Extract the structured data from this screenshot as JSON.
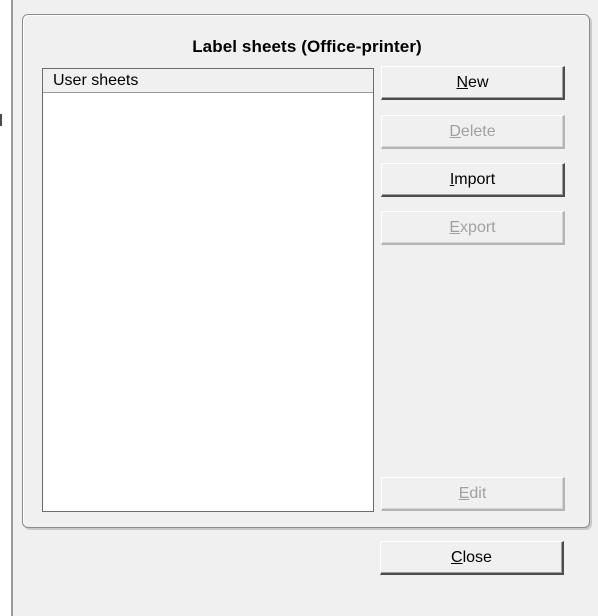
{
  "dialog": {
    "group_title": "Label sheets (Office-printer)",
    "list": {
      "header": "User sheets",
      "items": []
    },
    "buttons": {
      "new": {
        "accel": "N",
        "rest": "ew",
        "enabled": true
      },
      "delete": {
        "accel": "D",
        "rest": "elete",
        "enabled": false
      },
      "import": {
        "accel": "I",
        "rest": "mport",
        "enabled": true
      },
      "export": {
        "accel": "E",
        "rest": "xport",
        "enabled": false
      },
      "edit": {
        "accel": "E",
        "rest": "dit",
        "enabled": false
      },
      "close": {
        "accel": "C",
        "rest": "lose",
        "enabled": true
      }
    }
  },
  "colors": {
    "dialog_bg": "#f0f0f0",
    "disabled_text": "#a0a0a0"
  }
}
